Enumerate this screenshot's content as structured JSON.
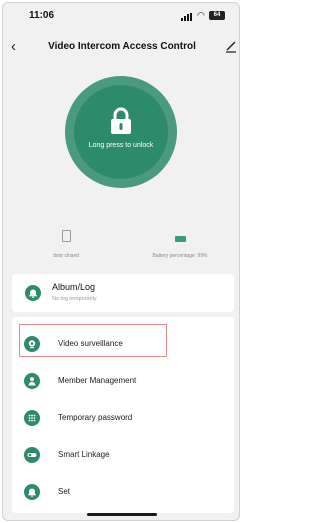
{
  "status_bar": {
    "time": "11:06",
    "battery": "64"
  },
  "header": {
    "title": "Video Intercom Access Control",
    "subtitle": ""
  },
  "unlock": {
    "label": "Long press to unlock"
  },
  "device_status": {
    "door": {
      "label": "door closed"
    },
    "battery": {
      "label": "Battery percentage: 99%"
    }
  },
  "album": {
    "title": "Album/Log",
    "subtitle": "No log temporarily"
  },
  "menu": {
    "items": [
      {
        "label": "Video surveillance"
      },
      {
        "label": "Member Management"
      },
      {
        "label": "Temporary password"
      },
      {
        "label": "Smart Linkage"
      },
      {
        "label": "Set"
      }
    ]
  },
  "colors": {
    "accent": "#2d8b6b",
    "ring": "#4a9a7f",
    "highlight": "#e58b86"
  }
}
